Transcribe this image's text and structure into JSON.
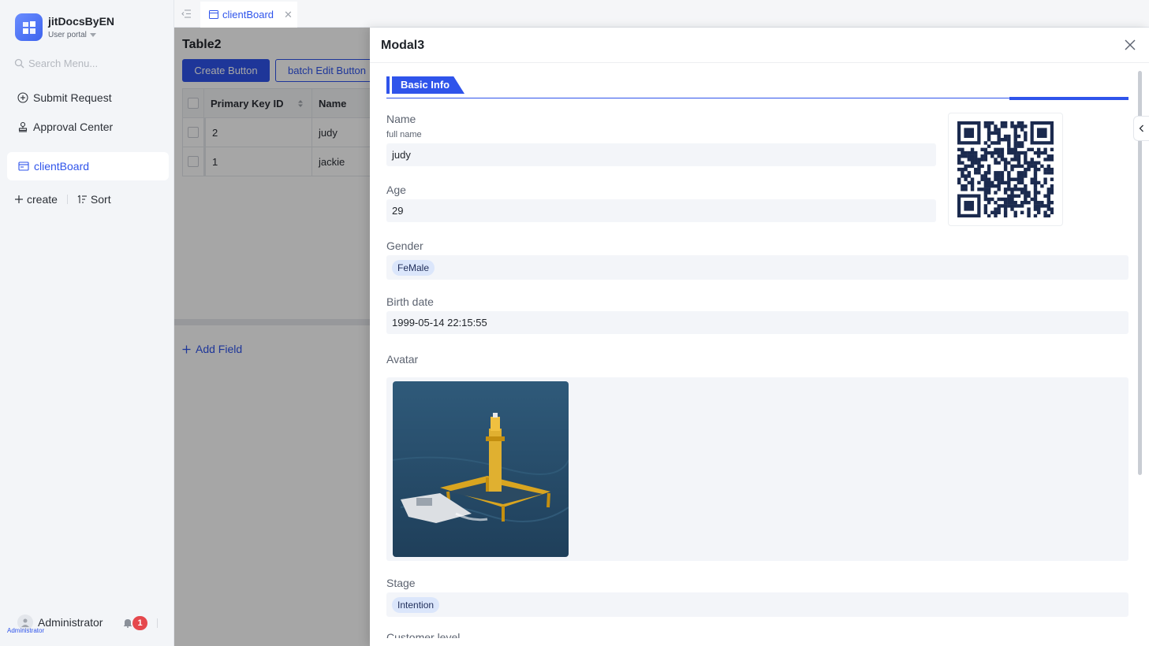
{
  "app": {
    "name": "jitDocsByEN",
    "portal": "User portal"
  },
  "sidebar": {
    "search_placeholder": "Search Menu...",
    "items": [
      {
        "label": "Submit Request",
        "icon": "plus-circle-icon"
      },
      {
        "label": "Approval Center",
        "icon": "stamp-icon"
      }
    ],
    "active_item": {
      "label": "clientBoard",
      "icon": "board-icon"
    },
    "actions": {
      "create": "create",
      "sort": "Sort"
    },
    "user": {
      "name": "Administrator",
      "tag": "Administrator",
      "notifications": "1"
    }
  },
  "tabs": [
    {
      "label": "clientBoard",
      "active": true
    }
  ],
  "main": {
    "table_title": "Table2",
    "create_button": "Create Button",
    "batch_edit_button": "batch Edit Button",
    "columns": [
      "Primary Key ID",
      "Name"
    ],
    "rows": [
      {
        "id": "2",
        "name": "judy"
      },
      {
        "id": "1",
        "name": "jackie"
      }
    ],
    "add_field": "Add Field"
  },
  "modal": {
    "title": "Modal3",
    "section": "Basic Info",
    "fields": {
      "name": {
        "label": "Name",
        "description": "full name",
        "value": "judy"
      },
      "age": {
        "label": "Age",
        "value": "29"
      },
      "gender": {
        "label": "Gender",
        "value": "FeMale"
      },
      "birth_date": {
        "label": "Birth date",
        "value": "1999-05-14 22:15:55"
      },
      "avatar": {
        "label": "Avatar"
      },
      "stage": {
        "label": "Stage",
        "value": "Intention"
      },
      "next": {
        "label": "Customer level"
      }
    }
  },
  "colors": {
    "primary": "#2f54eb",
    "badge": "#e5484d",
    "tag_bg": "#dbe6fb"
  }
}
